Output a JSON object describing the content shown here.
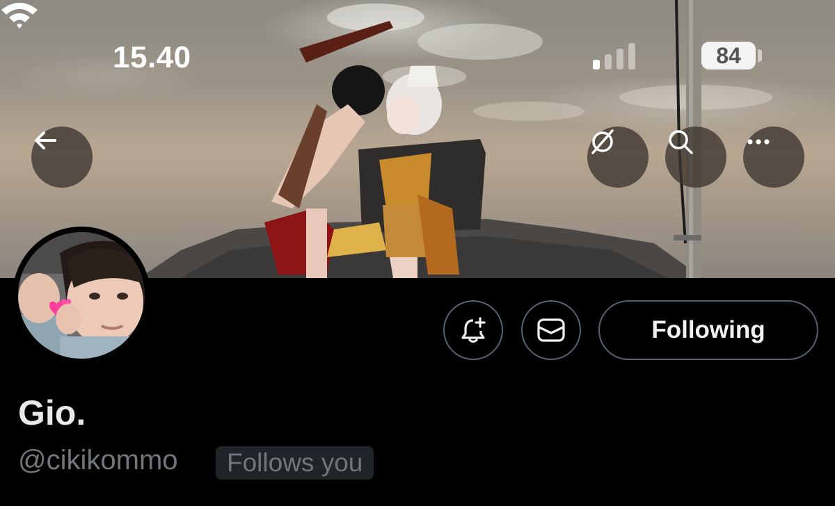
{
  "status_bar": {
    "time": "15.40",
    "battery_level": "84",
    "signal_bars_active": 1,
    "signal_bars_total": 4
  },
  "header": {
    "back_icon": "arrow-left-icon",
    "translate_icon": "slashed-globe-icon",
    "search_icon": "search-icon",
    "more_icon": "more-horizontal-icon"
  },
  "profile": {
    "display_name": "Gio.",
    "handle": "@cikikommo",
    "follows_you_label": "Follows you"
  },
  "actions": {
    "notify_icon": "bell-plus-icon",
    "message_icon": "envelope-icon",
    "following_label": "Following"
  },
  "colors": {
    "background": "#000000",
    "border": "#536471",
    "secondary_text": "#71767b",
    "badge_bg": "#202327",
    "header_button_bg": "#3c3430"
  }
}
